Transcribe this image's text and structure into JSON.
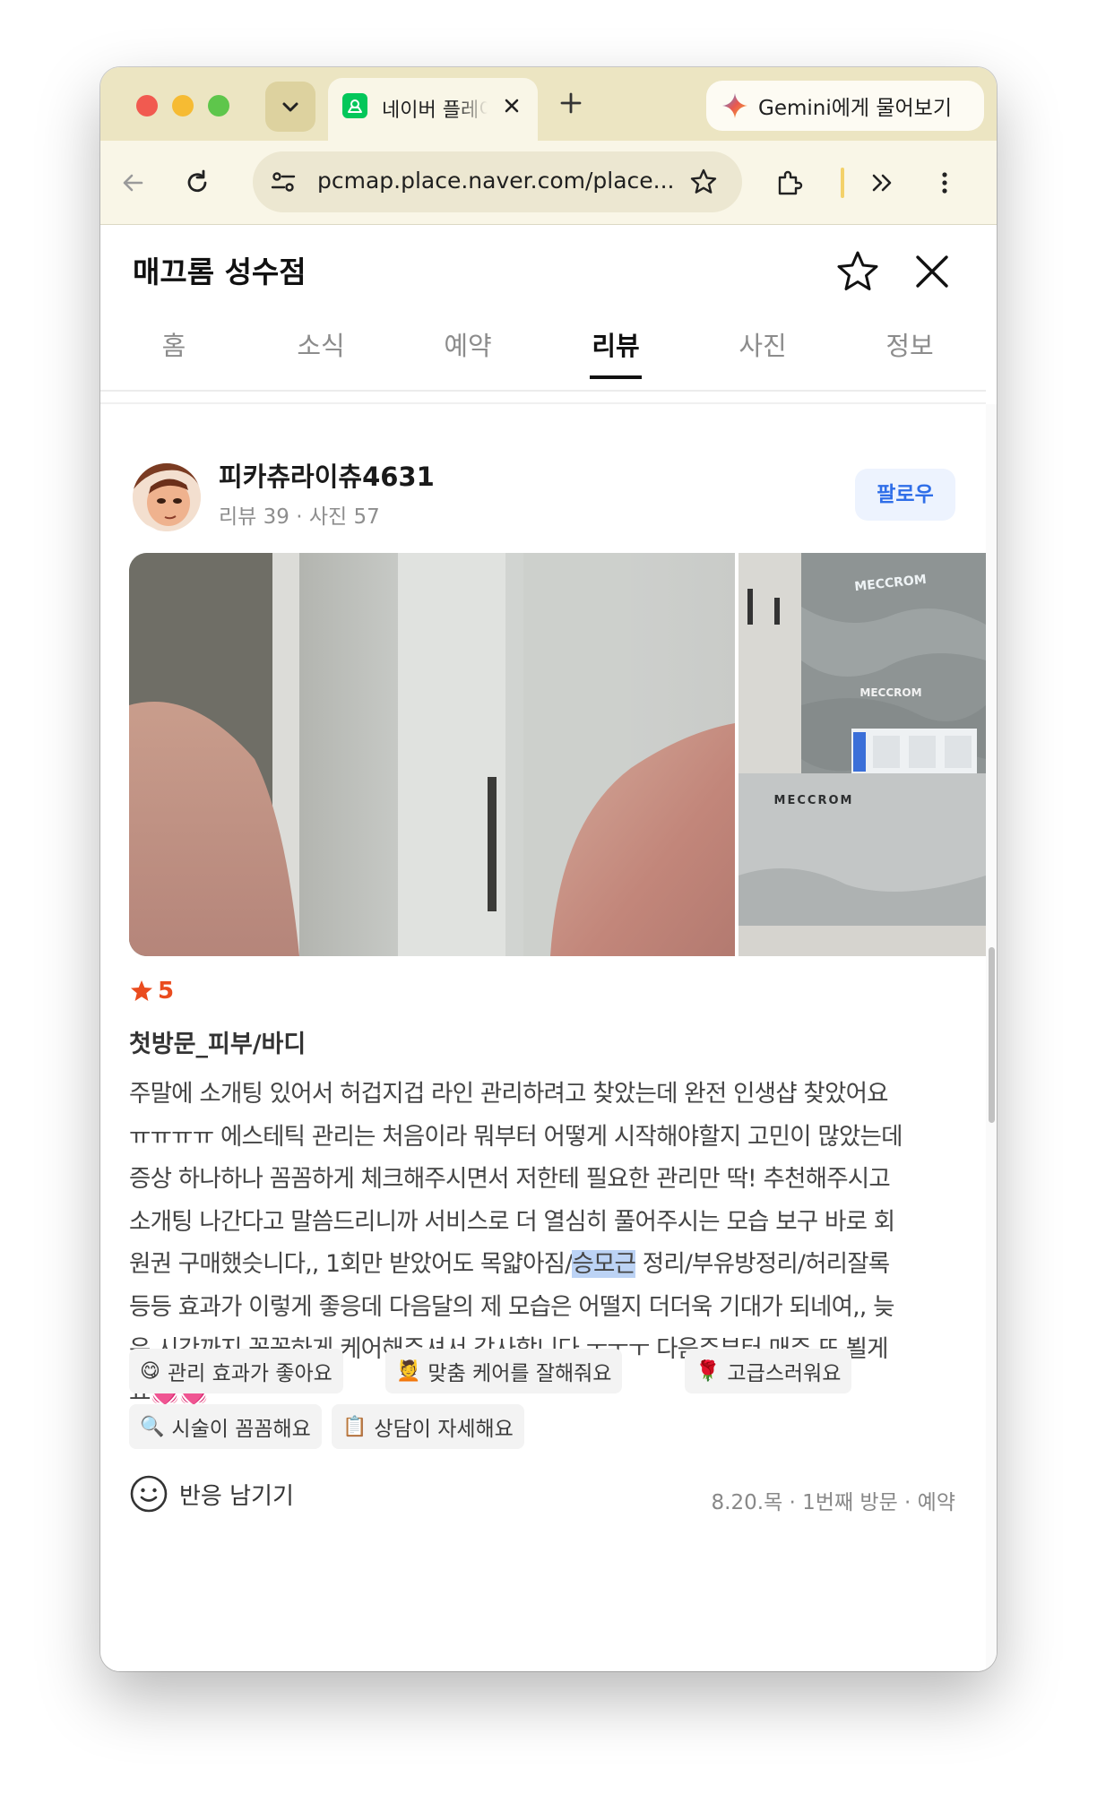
{
  "browser": {
    "tab_title": "네이버 플레이스",
    "new_tab_symbol": "+",
    "gemini_label": "Gemini에게 물어보기",
    "url": "pcmap.place.naver.com/place..."
  },
  "place": {
    "title": "매끄롬 성수점",
    "tabs": [
      "홈",
      "소식",
      "예약",
      "리뷰",
      "사진",
      "정보"
    ],
    "active_tab": "리뷰"
  },
  "review": {
    "user_name": "피카츄라이츄4631",
    "user_stats": "리뷰 39 · 사진 57",
    "follow_label": "팔로우",
    "photo_side_signs": [
      "MECCROM",
      "MECCROM",
      "MECCROM"
    ],
    "rating": "5",
    "visit_title": "첫방문_피부/바디",
    "body_lines": [
      "주말에 소개팅 있어서 허겁지겁 라인 관리하려고 찾았는데 완전 인생샵 찾았어요",
      "ㅠㅠㅠㅠ 에스테틱 관리는 처음이라 뭐부터 어떻게 시작해야할지 고민이 많았는데",
      "증상 하나하나 꼼꼼하게 체크해주시면서 저한테 필요한 관리만 딱! 추천해주시고",
      "소개팅 나간다고 말씀드리니까 서비스로 더 열심히 풀어주시는 모습 보구 바로 회",
      "원권 구매했슷니다,, 1회만 받았어도 목얇아짐/",
      "승모근",
      " 정리/부유방정리/허리잘록",
      "등등 효과가 이렇게 좋응데 다음달의 제 모습은 어떨지 더더욱 기대가 되네여,, 늦",
      "은 시간까지 꼼꼼하게 케어해주셔서 감사합니다 ㅜㅜㅜ 다음주부터 매주 또 뵐게",
      "요💓💓"
    ],
    "tags": [
      {
        "emoji": "😋",
        "label": "관리 효과가 좋아요"
      },
      {
        "emoji": "💆",
        "label": "맞춤 케어를 잘해줘요"
      },
      {
        "emoji": "🌹",
        "label": "고급스러워요"
      },
      {
        "emoji": "🔍",
        "label": "시술이 꼼꼼해요"
      },
      {
        "emoji": "📋",
        "label": "상담이 자세해요"
      }
    ],
    "react_label": "반응 남기기",
    "visit_meta": "8.20.목 · 1번째 방문 · 예약"
  },
  "colors": {
    "tabstrip_bg": "#ece5c2",
    "toolbar_bg": "#f9f6e7",
    "rating_star": "#ea4c1f",
    "follow_text": "#2f6ee8",
    "highlight": "#bcd3f5"
  }
}
